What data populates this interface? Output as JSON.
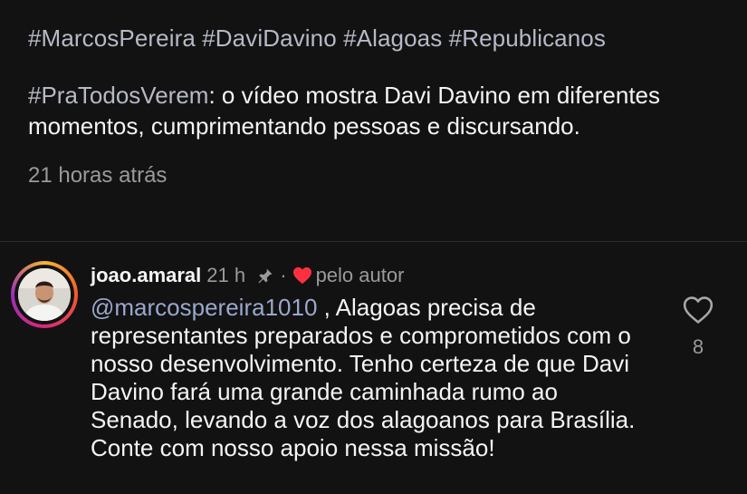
{
  "caption": {
    "hashtags": [
      "#MarcosPereira",
      "#DaviDavino",
      "#Alagoas",
      "#Republicanos"
    ],
    "alt_tag": "#PraTodosVerem",
    "alt_text": ": o vídeo mostra Davi Davino em diferentes momentos, cumprimentando pessoas e discursando.",
    "timestamp": "21 horas atrás"
  },
  "comment": {
    "username": "joao.amaral",
    "time": "21 h",
    "separator": "·",
    "liked_by_author": "pelo autor",
    "mention": "@marcospereira1010",
    "text": " , Alagoas precisa de representantes preparados e comprometidos com o nosso desenvolvimento. Tenho certeza de que Davi Davino fará uma grande caminhada rumo ao Senado, levando a voz dos alagoanos para Brasília. Conte com nosso apoio nessa missão!",
    "like_count": "8",
    "icons": {
      "pin": "pin-icon",
      "liked": "heart-filled-icon",
      "like": "heart-outline-icon"
    }
  },
  "colors": {
    "background": "#121212",
    "heart": "#ff3040",
    "hashtag": "#b6b9c7",
    "mention": "#9aa8cc",
    "muted": "#9a9a9a"
  }
}
